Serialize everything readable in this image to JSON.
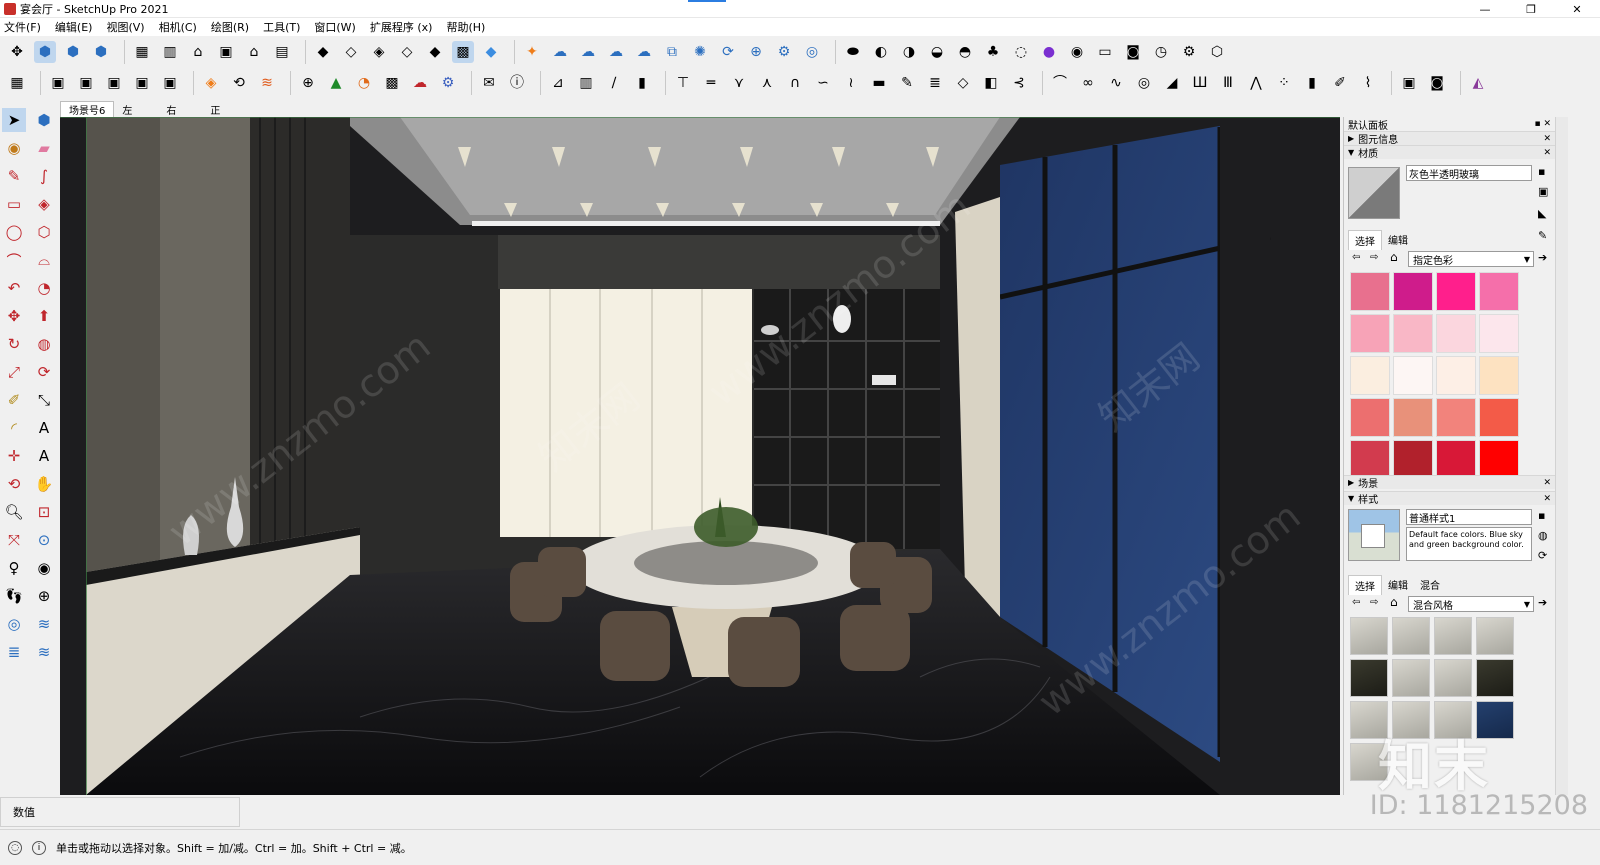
{
  "window": {
    "title": "宴会厅 - SketchUp Pro 2021",
    "controls": [
      "—",
      "❐",
      "✕"
    ]
  },
  "menu": [
    "文件(F)",
    "编辑(E)",
    "视图(V)",
    "相机(C)",
    "绘图(R)",
    "工具(T)",
    "窗口(W)",
    "扩展程序 (x)",
    "帮助(H)"
  ],
  "toolbar1_icons": [
    "move-icon",
    "iso-view-icon",
    "top-view-icon",
    "front-view-icon",
    "components-icon",
    "section-icon",
    "home-icon",
    "warehouse-icon",
    "house-outline-icon",
    "house-roof-icon",
    "solid-icon",
    "xray-icon",
    "wireframe-icon",
    "hidden-line-icon",
    "shaded-icon",
    "textured-icon",
    "monochrome-icon",
    "extension-warehouse-icon",
    "cloud-sync-icon",
    "cloud-upload-icon",
    "cloud-icon",
    "cloud-share-icon",
    "export-icon",
    "network-icon",
    "refresh-icon",
    "download-icon",
    "settings-icon",
    "chrome-icon",
    "shape-1-icon",
    "shape-2-icon",
    "shape-3-icon",
    "shape-4-icon",
    "shape-5-icon",
    "shape-6-icon",
    "shadow-icon",
    "profile-icon",
    "record-icon",
    "video-icon",
    "camera-icon",
    "timer-icon",
    "gear-outline-icon",
    "cube-outline-icon"
  ],
  "toolbar2_icons": [
    "group-icon",
    "stack-1-icon",
    "stack-2-icon",
    "stack-3-icon",
    "stack-4-icon",
    "stack-5-icon",
    "brand-logo-icon",
    "rotate-icon",
    "layers-icon",
    "plus-circle-icon",
    "tree-icon",
    "pie-icon",
    "checker-icon",
    "cloud-flame-icon",
    "gear-colored-icon",
    "mail-icon",
    "info-icon",
    "stairs-icon",
    "grid-icon",
    "line-icon",
    "bars-icon",
    "beam-icon",
    "rail-icon",
    "branch-icon",
    "tree-branch-icon",
    "arch-icon",
    "curve-icon",
    "wave-icon",
    "plank-icon",
    "pen-icon",
    "stack-planks-icon",
    "diamond-icon",
    "box-icon",
    "spread-icon",
    "arc-icon",
    "chain-icon",
    "swoosh-icon",
    "target-icon",
    "ramp-icon",
    "columns-icon",
    "fence-icon",
    "truss-icon",
    "grid-dots-icon",
    "slab-icon",
    "brush-icon",
    "broom-icon",
    "film-icon",
    "lens-icon",
    "prism-icon"
  ],
  "left_tools": [
    "select-arrow-icon",
    "component-tool-icon",
    "paint-bucket-icon",
    "eraser-icon",
    "pencil-icon",
    "freehand-icon",
    "rectangle-icon",
    "rotated-rect-icon",
    "circle-icon",
    "polygon-icon",
    "arc-icon",
    "arc2-icon",
    "arc3-icon",
    "pie-arc-icon",
    "move-tool-icon",
    "push-pull-icon",
    "rotate-tool-icon",
    "follow-me-icon",
    "scale-icon",
    "offset-icon",
    "tape-measure-icon",
    "dimension-icon",
    "protractor-icon",
    "text-icon",
    "axes-icon",
    "3d-text-icon",
    "orbit-icon",
    "pan-icon",
    "zoom-icon",
    "zoom-window-icon",
    "zoom-extents-icon",
    "zoom-previous-icon",
    "position-camera-icon",
    "look-around-icon",
    "walk-icon",
    "section-plane-icon",
    "sandbox-icon",
    "smoove-icon",
    "stamp-icon",
    "drape-icon"
  ],
  "scene_tabs": {
    "label": "场景号6",
    "tabs": [
      "左",
      "右",
      "正"
    ]
  },
  "tray": {
    "title": "默认面板",
    "entity_info": "图元信息",
    "materials": {
      "header": "材质",
      "current": "灰色半透明玻璃",
      "tabs": [
        "选择",
        "编辑"
      ],
      "library": "指定色彩",
      "swatches": [
        "#e8708e",
        "#cf1c8b",
        "#ff1f8c",
        "#f56faa",
        "#f7a3b7",
        "#f9b7c6",
        "#fbd6de",
        "#fce6ec",
        "#fbeee0",
        "#fdf6f4",
        "#fdefe6",
        "#fde2c1",
        "#ec6f6f",
        "#e8917a",
        "#f2837c",
        "#f35b48",
        "#d23b4e",
        "#b1212c",
        "#d81837",
        "#ff0000"
      ]
    },
    "scenes": {
      "header": "场景"
    },
    "styles": {
      "header": "样式",
      "current": "普通样式1",
      "description": "Default face colors. Blue sky and green background color.",
      "tabs": [
        "选择",
        "编辑",
        "混合"
      ],
      "library": "混合风格"
    }
  },
  "measurements": {
    "label": "数值",
    "value": ""
  },
  "status": {
    "hint": "单击或拖动以选择对象。Shift = 加/减。Ctrl = 加。Shift + Ctrl = 减。"
  },
  "watermark": {
    "site": "www.znzmo.com",
    "brand": "知末网",
    "logo": "知末",
    "id": "ID: 1181215208"
  }
}
